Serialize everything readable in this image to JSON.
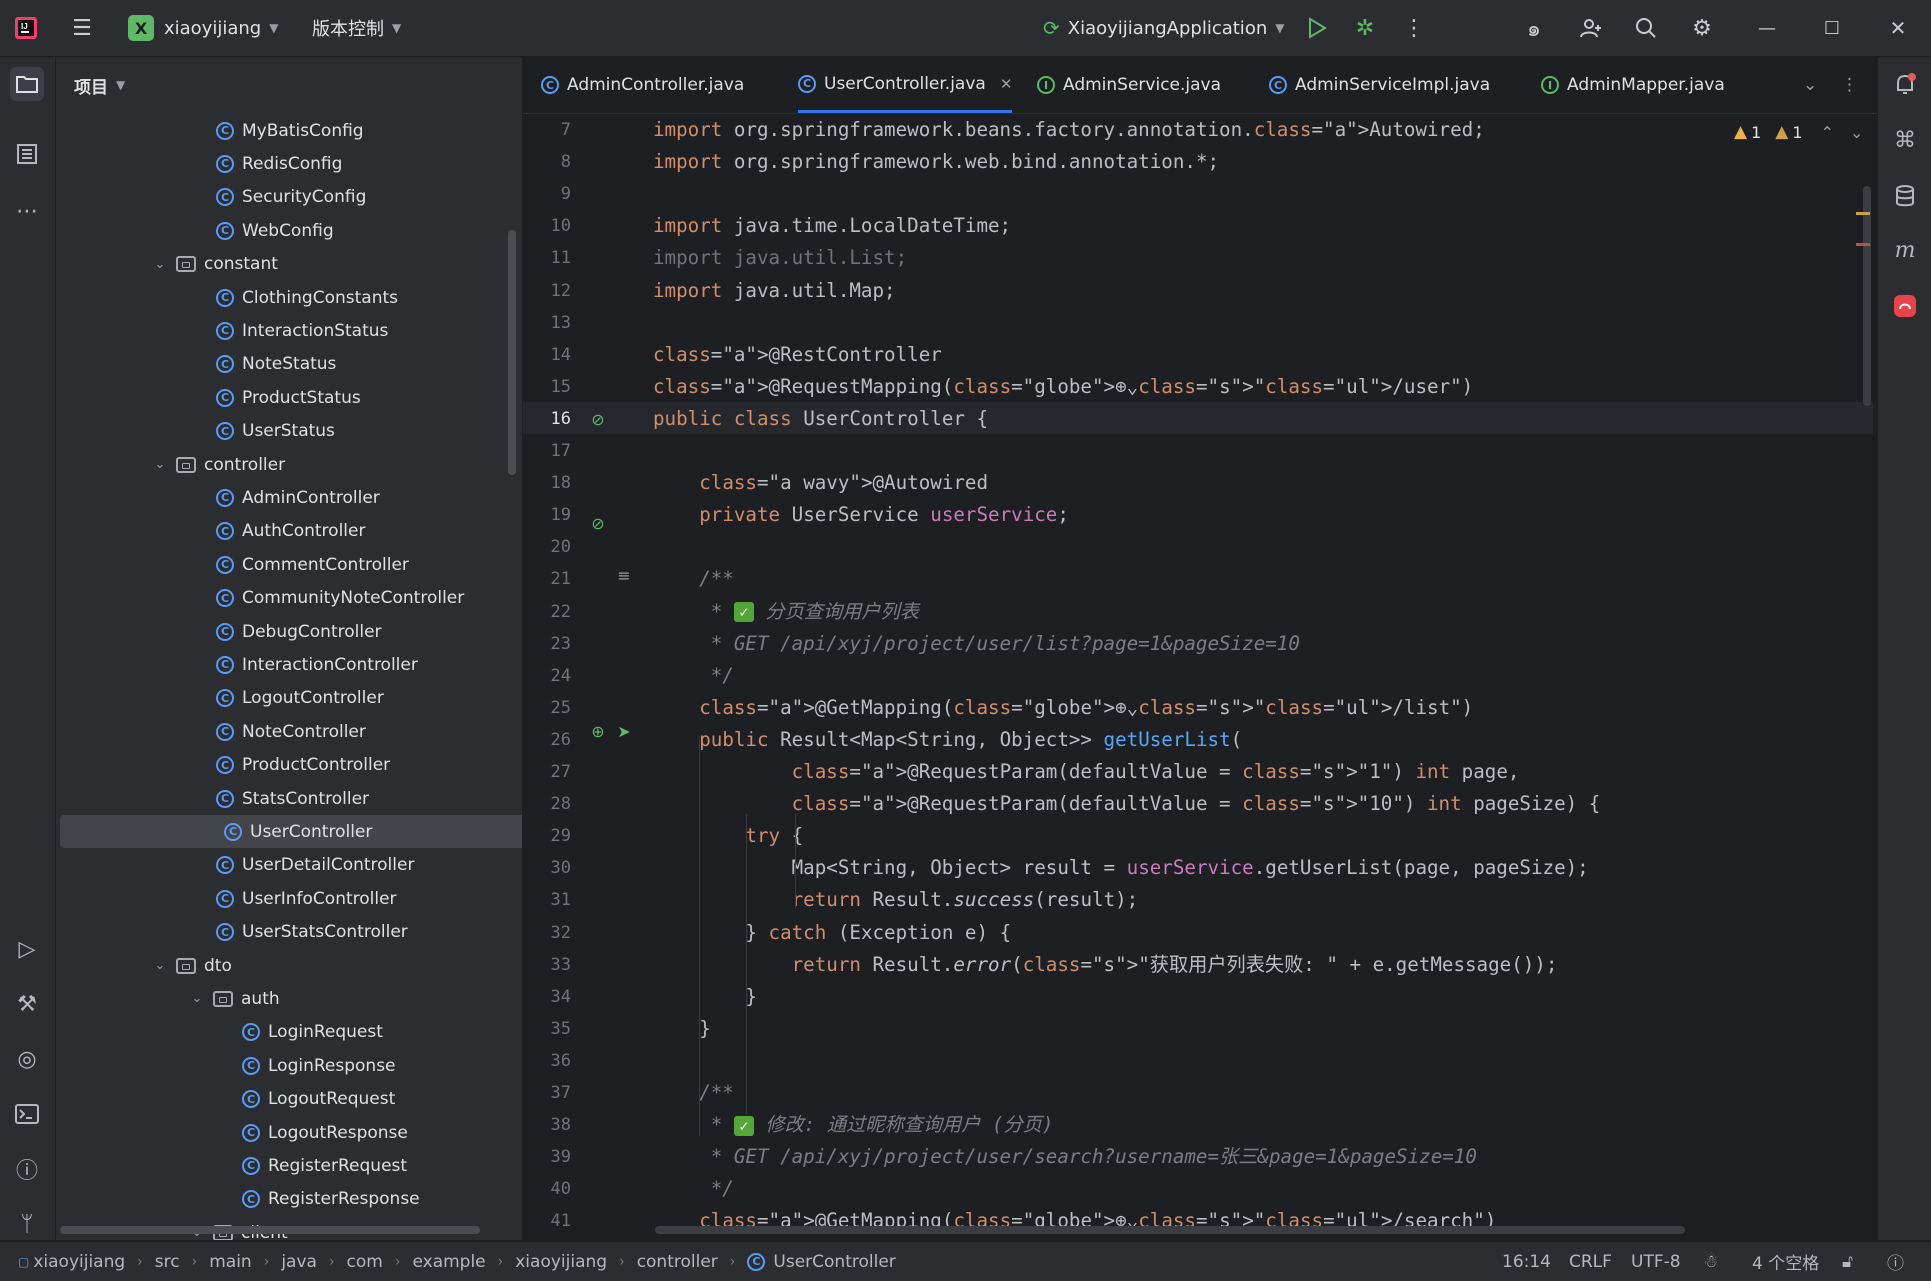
{
  "titlebar": {
    "project_initial": "X",
    "project_name": "xiaoyijiang",
    "vcs_label": "版本控制",
    "run_config": "XiaoyijiangApplication"
  },
  "project_panel": {
    "title": "项目",
    "tree": [
      {
        "label": "MyBatisConfig",
        "kind": "class",
        "depth": 2
      },
      {
        "label": "RedisConfig",
        "kind": "class",
        "depth": 2
      },
      {
        "label": "SecurityConfig",
        "kind": "class",
        "depth": 2
      },
      {
        "label": "WebConfig",
        "kind": "class",
        "depth": 2
      },
      {
        "label": "constant",
        "kind": "folder",
        "depth": 1
      },
      {
        "label": "ClothingConstants",
        "kind": "class",
        "depth": 2
      },
      {
        "label": "InteractionStatus",
        "kind": "class",
        "depth": 2
      },
      {
        "label": "NoteStatus",
        "kind": "class",
        "depth": 2
      },
      {
        "label": "ProductStatus",
        "kind": "class",
        "depth": 2
      },
      {
        "label": "UserStatus",
        "kind": "class",
        "depth": 2
      },
      {
        "label": "controller",
        "kind": "folder",
        "depth": 1
      },
      {
        "label": "AdminController",
        "kind": "class",
        "depth": 2
      },
      {
        "label": "AuthController",
        "kind": "class",
        "depth": 2
      },
      {
        "label": "CommentController",
        "kind": "class",
        "depth": 2
      },
      {
        "label": "CommunityNoteController",
        "kind": "class",
        "depth": 2
      },
      {
        "label": "DebugController",
        "kind": "class",
        "depth": 2
      },
      {
        "label": "InteractionController",
        "kind": "class",
        "depth": 2
      },
      {
        "label": "LogoutController",
        "kind": "class",
        "depth": 2
      },
      {
        "label": "NoteController",
        "kind": "class",
        "depth": 2
      },
      {
        "label": "ProductController",
        "kind": "class",
        "depth": 2
      },
      {
        "label": "StatsController",
        "kind": "class",
        "depth": 2
      },
      {
        "label": "UserController",
        "kind": "class",
        "depth": 2,
        "selected": true
      },
      {
        "label": "UserDetailController",
        "kind": "class",
        "depth": 2
      },
      {
        "label": "UserInfoController",
        "kind": "class",
        "depth": 2
      },
      {
        "label": "UserStatsController",
        "kind": "class",
        "depth": 2
      },
      {
        "label": "dto",
        "kind": "folder",
        "depth": 1
      },
      {
        "label": "auth",
        "kind": "folder",
        "depth": 2
      },
      {
        "label": "LoginRequest",
        "kind": "class",
        "depth": 3
      },
      {
        "label": "LoginResponse",
        "kind": "class",
        "depth": 3
      },
      {
        "label": "LogoutRequest",
        "kind": "class",
        "depth": 3
      },
      {
        "label": "LogoutResponse",
        "kind": "class",
        "depth": 3
      },
      {
        "label": "RegisterRequest",
        "kind": "class",
        "depth": 3
      },
      {
        "label": "RegisterResponse",
        "kind": "class",
        "depth": 3
      },
      {
        "label": "client",
        "kind": "folder",
        "depth": 2
      }
    ]
  },
  "tabs": [
    {
      "label": "AdminController.java",
      "kind": "class"
    },
    {
      "label": "UserController.java",
      "kind": "class",
      "active": true
    },
    {
      "label": "AdminService.java",
      "kind": "interface"
    },
    {
      "label": "AdminServiceImpl.java",
      "kind": "class"
    },
    {
      "label": "AdminMapper.java",
      "kind": "interface"
    }
  ],
  "editor": {
    "warnings": "1",
    "weak_warnings": "1",
    "current_line": 16,
    "lines": [
      {
        "n": 7,
        "t": "import org.springframework.beans.factory.annotation.Autowired;"
      },
      {
        "n": 8,
        "t": "import org.springframework.web.bind.annotation.*;"
      },
      {
        "n": 9,
        "t": ""
      },
      {
        "n": 10,
        "t": "import java.time.LocalDateTime;"
      },
      {
        "n": 11,
        "t": "import java.util.List;"
      },
      {
        "n": 12,
        "t": "import java.util.Map;"
      },
      {
        "n": 13,
        "t": ""
      },
      {
        "n": 14,
        "t": "@RestController"
      },
      {
        "n": 15,
        "t": "@RequestMapping(\"/user\")"
      },
      {
        "n": 16,
        "t": "public class UserController {"
      },
      {
        "n": 17,
        "t": ""
      },
      {
        "n": 18,
        "t": "    @Autowired"
      },
      {
        "n": 19,
        "t": "    private UserService userService;"
      },
      {
        "n": 20,
        "t": ""
      },
      {
        "n": 21,
        "t": "    /**"
      },
      {
        "n": 22,
        "t": "     * 分页查询用户列表"
      },
      {
        "n": 23,
        "t": "     * GET /api/xyj/project/user/list?page=1&pageSize=10"
      },
      {
        "n": 24,
        "t": "     */"
      },
      {
        "n": 25,
        "t": "    @GetMapping(\"/list\")"
      },
      {
        "n": 26,
        "t": "    public Result<Map<String, Object>> getUserList("
      },
      {
        "n": 27,
        "t": "            @RequestParam(defaultValue = \"1\") int page,"
      },
      {
        "n": 28,
        "t": "            @RequestParam(defaultValue = \"10\") int pageSize) {"
      },
      {
        "n": 29,
        "t": "        try {"
      },
      {
        "n": 30,
        "t": "            Map<String, Object> result = userService.getUserList(page, pageSize);"
      },
      {
        "n": 31,
        "t": "            return Result.success(result);"
      },
      {
        "n": 32,
        "t": "        } catch (Exception e) {"
      },
      {
        "n": 33,
        "t": "            return Result.error(\"获取用户列表失败: \" + e.getMessage());"
      },
      {
        "n": 34,
        "t": "        }"
      },
      {
        "n": 35,
        "t": "    }"
      },
      {
        "n": 36,
        "t": ""
      },
      {
        "n": 37,
        "t": "    /**"
      },
      {
        "n": 38,
        "t": "     * 修改: 通过昵称查询用户 (分页)"
      },
      {
        "n": 39,
        "t": "     * GET /api/xyj/project/user/search?username=张三&page=1&pageSize=10"
      },
      {
        "n": 40,
        "t": "     */"
      },
      {
        "n": 41,
        "t": "    @GetMapping(\"/search\")"
      }
    ]
  },
  "statusbar": {
    "breadcrumbs": [
      "xiaoyijiang",
      "src",
      "main",
      "java",
      "com",
      "example",
      "xiaoyijiang",
      "controller",
      "UserController"
    ],
    "position": "16:14",
    "line_separator": "CRLF",
    "encoding": "UTF-8",
    "indent": "4 个空格"
  },
  "colors": {
    "background": "#1e1f22",
    "panel": "#2b2d30",
    "accent": "#3574f0",
    "keyword": "#cf8e6d",
    "annotation": "#b3ae60",
    "string": "#6aab73",
    "method": "#56a8f5",
    "field": "#c77dbb"
  }
}
